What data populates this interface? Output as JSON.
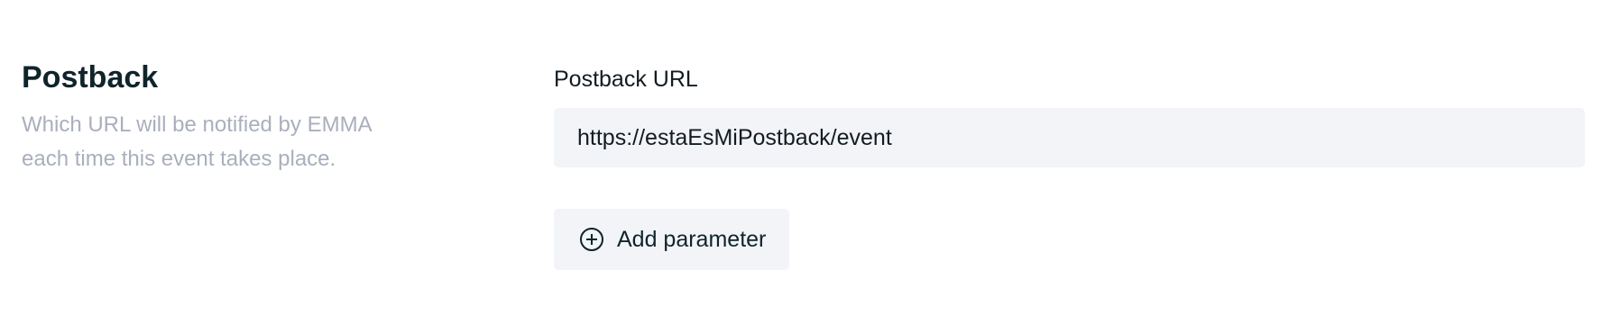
{
  "postback_section": {
    "title": "Postback",
    "description": "Which URL will be notified by EMMA each time this event takes place.",
    "url_field": {
      "label": "Postback URL",
      "value": "https://estaEsMiPostback/event",
      "placeholder": ""
    },
    "add_parameter": {
      "label": "Add parameter",
      "icon": "plus-circle-icon"
    }
  },
  "colors": {
    "title_text": "#10242b",
    "description_text": "#a9afbd",
    "input_background": "#f2f4f8",
    "body_text": "#131c22"
  }
}
